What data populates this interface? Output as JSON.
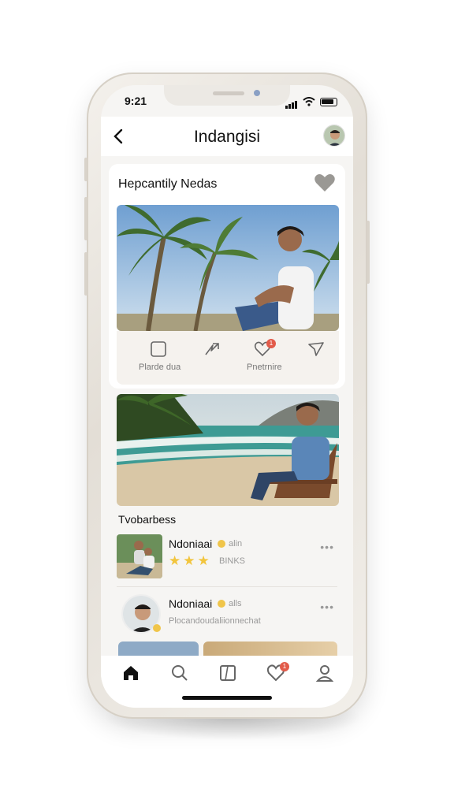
{
  "status_bar": {
    "time": "9:21"
  },
  "header": {
    "title": "Indangisi",
    "back_icon": "chevron-left-icon",
    "avatar_icon": "user-avatar"
  },
  "card": {
    "title": "Hepcantily Nedas",
    "favorite_icon": "heart-icon",
    "actions": [
      {
        "icon": "square-icon",
        "label": "Plarde dua"
      },
      {
        "icon": "share-arrow-icon",
        "label": ""
      },
      {
        "icon": "heart-icon",
        "label": "Pnetrnire",
        "badge": "1"
      },
      {
        "icon": "send-icon",
        "label": ""
      }
    ]
  },
  "section": {
    "label": "Tvobarbess"
  },
  "list": [
    {
      "name": "Ndoniaai",
      "tag": "alin",
      "stars": "★★★",
      "sub": "BINKS"
    },
    {
      "name": "Ndoniaai",
      "tag": "alls",
      "sub": "Plocandoudaliionnechat"
    }
  ],
  "tabbar": {
    "items": [
      "home-icon",
      "search-icon",
      "book-icon",
      "heart-icon",
      "profile-icon"
    ],
    "badge": "1"
  },
  "colors": {
    "accent": "#e25b4a",
    "star": "#f2c53d",
    "background": "#f6f5f3"
  }
}
